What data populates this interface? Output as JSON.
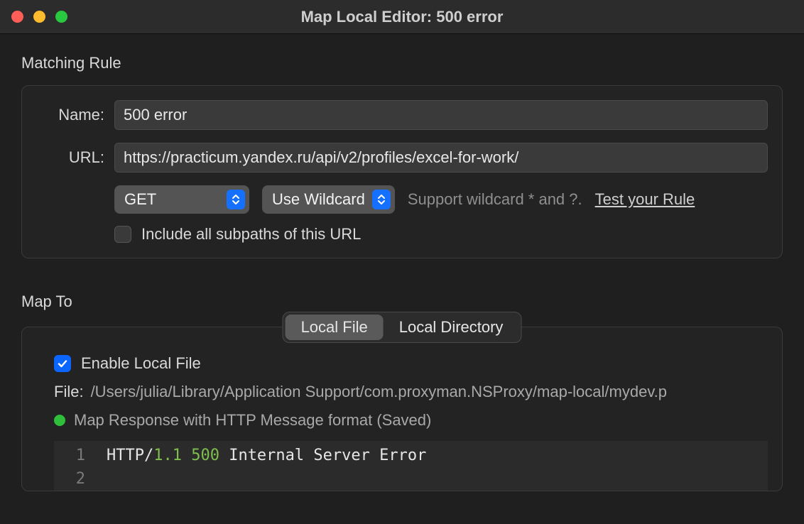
{
  "window": {
    "title": "Map Local Editor: 500 error"
  },
  "matching": {
    "section_label": "Matching Rule",
    "name_label": "Name:",
    "name_value": "500 error",
    "url_label": "URL:",
    "url_value": "https://practicum.yandex.ru/api/v2/profiles/excel-for-work/",
    "method": "GET",
    "wildcard_mode": "Use Wildcard",
    "hint": "Support wildcard * and ?.",
    "test_link": "Test your Rule",
    "include_subpaths_label": "Include all subpaths of this URL",
    "include_subpaths_checked": false
  },
  "mapto": {
    "section_label": "Map To",
    "tabs": {
      "local_file": "Local File",
      "local_directory": "Local Directory",
      "active": "local_file"
    },
    "enable_label": "Enable Local File",
    "enable_checked": true,
    "file_label": "File:",
    "file_path": "/Users/julia/Library/Application Support/com.proxyman.NSProxy/map-local/mydev.p",
    "status_text": "Map Response with HTTP Message format (Saved)",
    "editor_lines": [
      {
        "n": 1,
        "tokens": [
          {
            "t": "HTTP/",
            "c": "plain"
          },
          {
            "t": "1.1 500",
            "c": "num"
          },
          {
            "t": " Internal Server Error",
            "c": "plain"
          }
        ]
      },
      {
        "n": 2,
        "tokens": []
      }
    ]
  }
}
